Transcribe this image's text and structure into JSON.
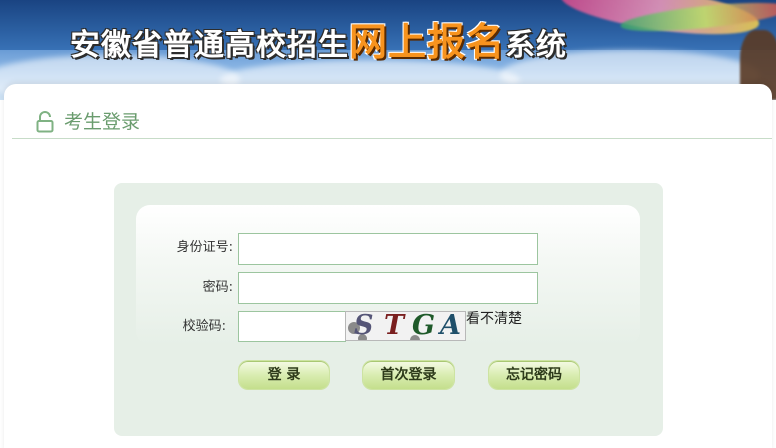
{
  "banner": {
    "title_prefix": "安徽省普通高校招生",
    "title_highlight": "网上报名",
    "title_suffix": "系统"
  },
  "section": {
    "title": "考生登录",
    "icon": "lock-icon"
  },
  "form": {
    "id_label": "身份证号:",
    "id_value": "",
    "password_label": "密码:",
    "password_value": "",
    "captcha_label": "校验码:",
    "captcha_value": "",
    "captcha_text": "STGA",
    "refresh_label": "看不清楚"
  },
  "buttons": {
    "login": "登 录",
    "first_login": "首次登录",
    "forgot_password": "忘记密码"
  },
  "colors": {
    "accent_orange": "#f7931e",
    "section_green": "#6a9c6e",
    "box_green": "#e6efe7",
    "button_green": "#d9edb1"
  }
}
